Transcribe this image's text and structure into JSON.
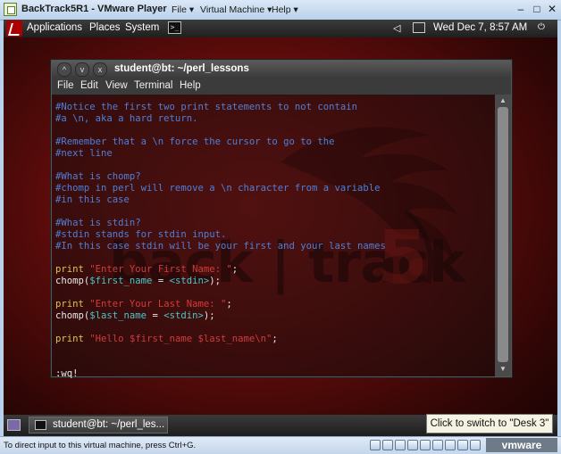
{
  "vm_window": {
    "title": "BackTrack5R1 - VMware Player",
    "menus": [
      "File ▾",
      "Virtual Machine ▾",
      "Help ▾"
    ],
    "controls": {
      "minimize": "–",
      "maximize": "□",
      "close": "✕"
    }
  },
  "top_panel": {
    "menus": [
      "Applications",
      "Places",
      "System"
    ],
    "terminal_launcher": ">_",
    "volume": "◁",
    "clock": "Wed Dec  7,  8:57 AM"
  },
  "desktop": {
    "wordmark": "back | track",
    "wordmark_number": "5"
  },
  "terminal": {
    "title": "student@bt: ~/perl_lessons",
    "title_controls": [
      "^",
      "v",
      "x"
    ],
    "menu": [
      "File",
      "Edit",
      "View",
      "Terminal",
      "Help"
    ],
    "lines": [
      [
        {
          "t": "#Notice the first two print statements to not contain",
          "c": "cmt"
        }
      ],
      [
        {
          "t": "#a \\n, aka a hard return.",
          "c": "cmt"
        }
      ],
      [],
      [
        {
          "t": "#Remember that a \\n force the cursor to go to the",
          "c": "cmt"
        }
      ],
      [
        {
          "t": "#next line",
          "c": "cmt"
        }
      ],
      [],
      [
        {
          "t": "#What is chomp?",
          "c": "cmt"
        }
      ],
      [
        {
          "t": "#chomp in perl will remove a \\n character from a variable",
          "c": "cmt"
        }
      ],
      [
        {
          "t": "#in this case",
          "c": "cmt"
        }
      ],
      [],
      [
        {
          "t": "#What is stdin?",
          "c": "cmt"
        }
      ],
      [
        {
          "t": "#stdin stands for stdin input.",
          "c": "cmt"
        }
      ],
      [
        {
          "t": "#In this case stdin will be your first and your last names",
          "c": "cmt"
        }
      ],
      [],
      [
        {
          "t": "print ",
          "c": "kw"
        },
        {
          "t": "\"Enter Your First Name: \"",
          "c": "str"
        },
        {
          "t": ";",
          "c": "plain"
        }
      ],
      [
        {
          "t": "chomp(",
          "c": "plain"
        },
        {
          "t": "$first_name",
          "c": "var"
        },
        {
          "t": " = ",
          "c": "plain"
        },
        {
          "t": "<stdin>",
          "c": "var"
        },
        {
          "t": ");",
          "c": "plain"
        }
      ],
      [],
      [
        {
          "t": "print ",
          "c": "kw"
        },
        {
          "t": "\"Enter Your Last Name: \"",
          "c": "str"
        },
        {
          "t": ";",
          "c": "plain"
        }
      ],
      [
        {
          "t": "chomp(",
          "c": "plain"
        },
        {
          "t": "$last_name",
          "c": "var"
        },
        {
          "t": " = ",
          "c": "plain"
        },
        {
          "t": "<stdin>",
          "c": "var"
        },
        {
          "t": ");",
          "c": "plain"
        }
      ],
      [],
      [
        {
          "t": "print ",
          "c": "kw"
        },
        {
          "t": "\"Hello ",
          "c": "str"
        },
        {
          "t": "$first_name $last_name",
          "c": "str"
        },
        {
          "t": "\\n\"",
          "c": "str"
        },
        {
          "t": ";",
          "c": "plain"
        }
      ],
      [],
      [],
      [
        {
          "t": ":wq!",
          "c": "plain"
        }
      ]
    ]
  },
  "bottom_panel": {
    "task_label": "student@bt: ~/perl_les...",
    "tooltip": "Click to switch to \"Desk 3\""
  },
  "statusbar": {
    "text": "To direct input to this virtual machine, press Ctrl+G.",
    "device_icons": [
      "hdd-icon",
      "cdrom-icon",
      "floppy-icon",
      "network-icon",
      "usb-icon",
      "printer-icon",
      "sound-icon",
      "display-icon",
      "messages-icon"
    ],
    "brand": "vmware"
  },
  "colors": {
    "comment": "#4f7fd8",
    "keyword": "#e0c44a",
    "string": "#d23b3b",
    "variable": "#4bc6c6"
  }
}
